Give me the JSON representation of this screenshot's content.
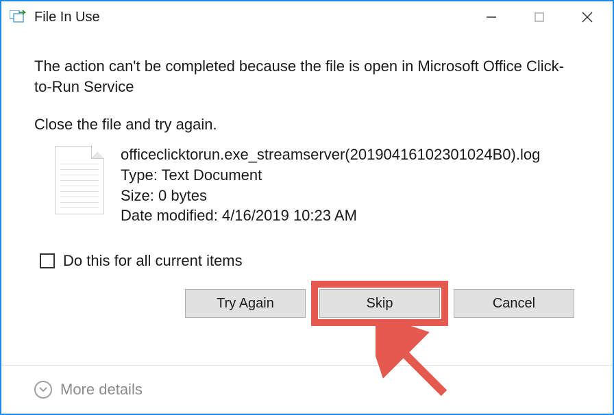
{
  "window": {
    "title": "File In Use"
  },
  "content": {
    "message": "The action can't be completed because the file is open in Microsoft Office Click-to-Run Service",
    "instruction": "Close the file and try again.",
    "file": {
      "name": "officeclicktorun.exe_streamserver(20190416102301024B0).log",
      "type_label": "Type: Text Document",
      "size_label": "Size: 0 bytes",
      "modified_label": "Date modified: 4/16/2019 10:23 AM"
    },
    "checkbox_label": "Do this for all current items"
  },
  "buttons": {
    "try_again": "Try Again",
    "skip": "Skip",
    "cancel": "Cancel"
  },
  "footer": {
    "more_details": "More details"
  }
}
